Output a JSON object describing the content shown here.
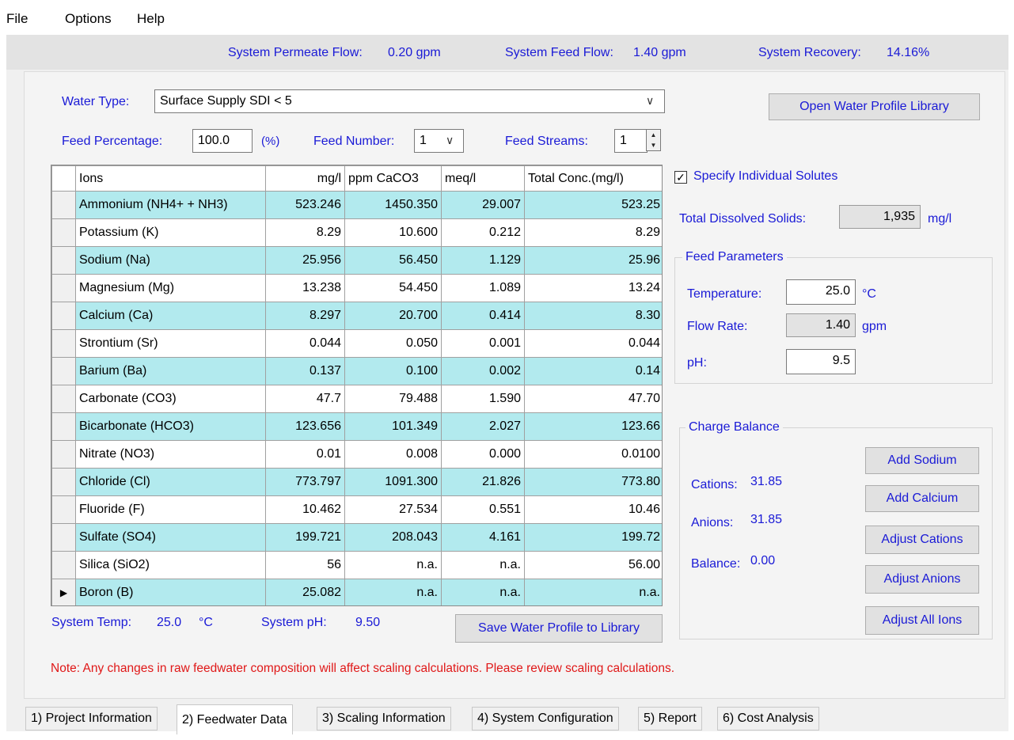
{
  "menu": {
    "file": "File",
    "options": "Options",
    "help": "Help"
  },
  "status": {
    "permeate_label": "System Permeate Flow:",
    "permeate_value": "0.20 gpm",
    "feed_label": "System Feed Flow:",
    "feed_value": "1.40 gpm",
    "recovery_label": "System Recovery:",
    "recovery_value": "14.16%"
  },
  "water": {
    "type_label": "Water Type:",
    "type_value": "Surface Supply SDI < 5",
    "feed_pct_label": "Feed Percentage:",
    "feed_pct_value": "100.0",
    "feed_pct_unit": "(%)",
    "feed_number_label": "Feed Number:",
    "feed_number_value": "1",
    "feed_streams_label": "Feed Streams:",
    "feed_streams_value": "1",
    "open_library": "Open Water Profile Library"
  },
  "grid": {
    "headers": [
      "Ions",
      "mg/l",
      "ppm CaCO3",
      "meq/l",
      "Total Conc.(mg/l)"
    ],
    "rows": [
      [
        "Ammonium (NH4+ + NH3)",
        "523.246",
        "1450.350",
        "29.007",
        "523.25"
      ],
      [
        "Potassium (K)",
        "8.29",
        "10.600",
        "0.212",
        "8.29"
      ],
      [
        "Sodium (Na)",
        "25.956",
        "56.450",
        "1.129",
        "25.96"
      ],
      [
        "Magnesium (Mg)",
        "13.238",
        "54.450",
        "1.089",
        "13.24"
      ],
      [
        "Calcium (Ca)",
        "8.297",
        "20.700",
        "0.414",
        "8.30"
      ],
      [
        "Strontium (Sr)",
        "0.044",
        "0.050",
        "0.001",
        "0.044"
      ],
      [
        "Barium (Ba)",
        "0.137",
        "0.100",
        "0.002",
        "0.14"
      ],
      [
        "Carbonate (CO3)",
        "47.7",
        "79.488",
        "1.590",
        "47.70"
      ],
      [
        "Bicarbonate (HCO3)",
        "123.656",
        "101.349",
        "2.027",
        "123.66"
      ],
      [
        "Nitrate (NO3)",
        "0.01",
        "0.008",
        "0.000",
        "0.0100"
      ],
      [
        "Chloride (Cl)",
        "773.797",
        "1091.300",
        "21.826",
        "773.80"
      ],
      [
        "Fluoride (F)",
        "10.462",
        "27.534",
        "0.551",
        "10.46"
      ],
      [
        "Sulfate (SO4)",
        "199.721",
        "208.043",
        "4.161",
        "199.72"
      ],
      [
        "Silica (SiO2)",
        "56",
        "n.a.",
        "n.a.",
        "56.00"
      ],
      [
        "Boron (B)",
        "25.082",
        "n.a.",
        "n.a.",
        "n.a."
      ]
    ],
    "current_row_marker": "▶"
  },
  "specify": {
    "label": "Specify Individual Solutes",
    "checked": true
  },
  "tds": {
    "label": "Total Dissolved Solids:",
    "value": "1,935",
    "unit": "mg/l"
  },
  "feed_params": {
    "title": "Feed Parameters",
    "temp_label": "Temperature:",
    "temp_value": "25.0",
    "temp_unit": "°C",
    "flow_label": "Flow Rate:",
    "flow_value": "1.40",
    "flow_unit": "gpm",
    "ph_label": "pH:",
    "ph_value": "9.5"
  },
  "charge": {
    "title": "Charge Balance",
    "cations_label": "Cations:",
    "cations_value": "31.85",
    "anions_label": "Anions:",
    "anions_value": "31.85",
    "balance_label": "Balance:",
    "balance_value": "0.00",
    "add_sodium": "Add Sodium",
    "add_calcium": "Add Calcium",
    "adjust_cations": "Adjust Cations",
    "adjust_anions": "Adjust Anions",
    "adjust_all": "Adjust All Ions"
  },
  "system": {
    "temp_label": "System Temp:",
    "temp_value": "25.0",
    "temp_unit": "°C",
    "ph_label": "System pH:",
    "ph_value": "9.50"
  },
  "save_button": "Save Water Profile to Library",
  "note": "Note: Any changes in raw feedwater composition will affect scaling calculations. Please review scaling calculations.",
  "tabs": [
    "1) Project Information",
    "2) Feedwater Data",
    "3) Scaling Information",
    "4) System Configuration",
    "5) Report",
    "6) Cost Analysis"
  ],
  "colors": {
    "accent_text": "#1a1ad6",
    "note_red": "#e01818",
    "row_highlight": "#b2eaee"
  }
}
